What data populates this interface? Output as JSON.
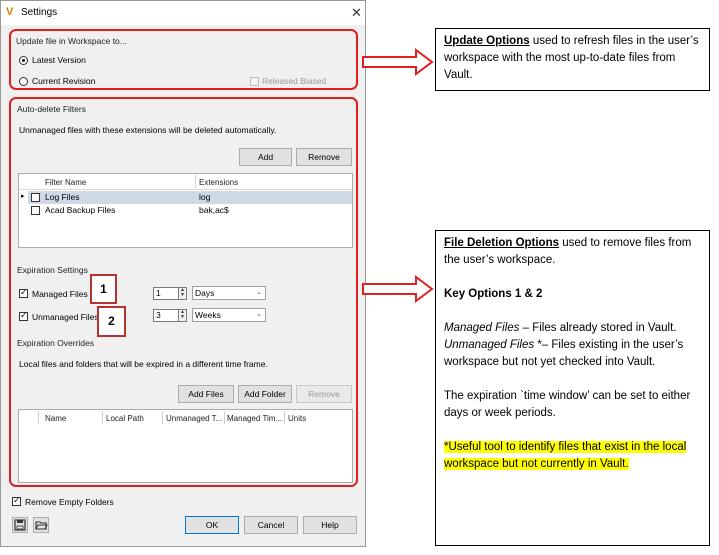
{
  "dialog": {
    "title": "Settings",
    "close_glyph": "✕",
    "update_group": {
      "label": "Update file in Workspace to...",
      "latest_version": "Latest Version",
      "current_revision": "Current Revision",
      "released_biased": "Released Biased"
    },
    "autodelete": {
      "label": "Auto-delete Filters",
      "description": "Unmanaged files with these extensions will be deleted automatically.",
      "add_label": "Add",
      "remove_label": "Remove",
      "columns": [
        "Filter Name",
        "Extensions"
      ],
      "rows": [
        {
          "name": "Log Files",
          "ext": "log"
        },
        {
          "name": "Acad Backup Files",
          "ext": "bak,ac$"
        }
      ]
    },
    "expiration": {
      "label": "Expiration Settings",
      "managed_label": "Managed Files",
      "managed_value": "1",
      "managed_unit": "Days",
      "unmanaged_label": "Unmanaged Files",
      "unmanaged_value": "3",
      "unmanaged_unit": "Weeks"
    },
    "overrides": {
      "label": "Expiration Overrides",
      "description": "Local files and folders that will be expired in a different time frame.",
      "add_files": "Add Files",
      "add_folder": "Add Folder",
      "remove": "Remove",
      "columns": [
        "Name",
        "Local Path",
        "Unmanaged T...",
        "Managed Tim...",
        "Units"
      ]
    },
    "remove_empty_folders": "Remove Empty Folders",
    "ok": "OK",
    "cancel": "Cancel",
    "help": "Help"
  },
  "annotations": {
    "box1": "1",
    "box2": "2",
    "callout_update": {
      "title": "Update Options",
      "text": " used to refresh files in the user’s workspace with the most up-to-date files from Vault."
    },
    "callout_delete": {
      "title": "File Deletion Options",
      "intro": " used to remove files from the user’s workspace.",
      "key_options": "Key Options 1 & 2",
      "managed_title": "Managed Files",
      "managed_text": " – Files already stored in Vault.",
      "unmanaged_title": "Unmanaged Files",
      "unmanaged_text": " *– Files existing in the user’s workspace but not yet checked into Vault.",
      "expiration_text": "The expiration `time window’ can be set to either days or week periods.",
      "note": "*Useful tool to identify files that exist in the local workspace but not currently in Vault."
    }
  },
  "colors": {
    "annotation_red": "#e02020",
    "highlight": "#ffff00",
    "dialog_bg": "#f0f0f0"
  }
}
